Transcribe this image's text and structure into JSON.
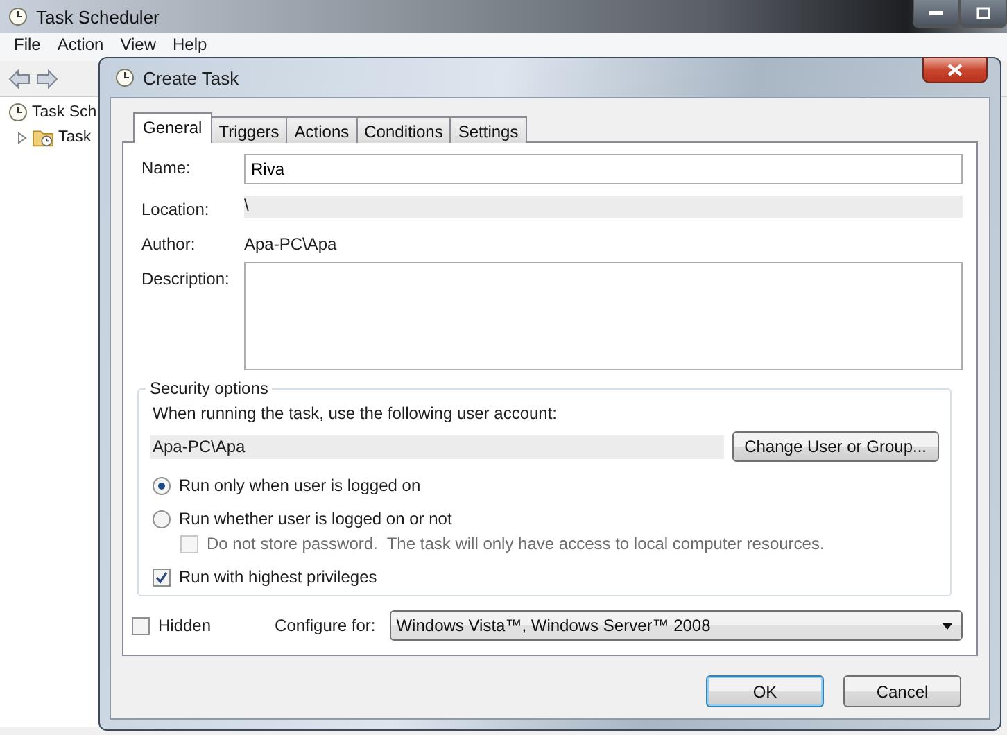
{
  "background_window": {
    "title": "Task Scheduler",
    "menu": [
      "File",
      "Action",
      "View",
      "Help"
    ],
    "tree": [
      {
        "label": "Task Sch",
        "children": [
          {
            "label": "Task",
            "expanded": false
          }
        ]
      }
    ]
  },
  "dialog": {
    "title": "Create Task",
    "tabs": [
      {
        "label": "General",
        "selected": true
      },
      {
        "label": "Triggers",
        "selected": false
      },
      {
        "label": "Actions",
        "selected": false
      },
      {
        "label": "Conditions",
        "selected": false
      },
      {
        "label": "Settings",
        "selected": false
      }
    ],
    "fields": [
      {
        "kind": "input",
        "label": "Name:",
        "value": "Riva"
      },
      {
        "kind": "readonly",
        "label": "Location:",
        "value": "\\"
      },
      {
        "kind": "text",
        "label": "Author:",
        "value": "Apa-PC\\Apa"
      },
      {
        "kind": "textarea",
        "label": "Description:"
      }
    ],
    "security": {
      "title": "Security options",
      "account_prompt": "When running the task, use the following user account:",
      "account": "Apa-PC\\Apa",
      "change_button": "Change User or Group...",
      "options": [
        {
          "kind": "radio",
          "label": "Run only when user is logged on",
          "selected": true,
          "disabled": false
        },
        {
          "kind": "radio",
          "label": "Run whether user is logged on or not",
          "selected": false,
          "disabled": false,
          "children": [
            {
              "kind": "checkbox",
              "label": "Do not store password.  The task will only have access to local computer resources.",
              "checked": false,
              "disabled": true
            }
          ]
        },
        {
          "kind": "checkbox",
          "label": "Run with highest privileges",
          "checked": true,
          "disabled": false
        }
      ]
    },
    "hidden": {
      "label": "Hidden",
      "checked": false
    },
    "configure": {
      "label": "Configure for:",
      "value": "Windows Vista™, Windows Server™ 2008"
    },
    "buttons": [
      {
        "label": "OK",
        "default": true
      },
      {
        "label": "Cancel",
        "default": false
      }
    ]
  }
}
